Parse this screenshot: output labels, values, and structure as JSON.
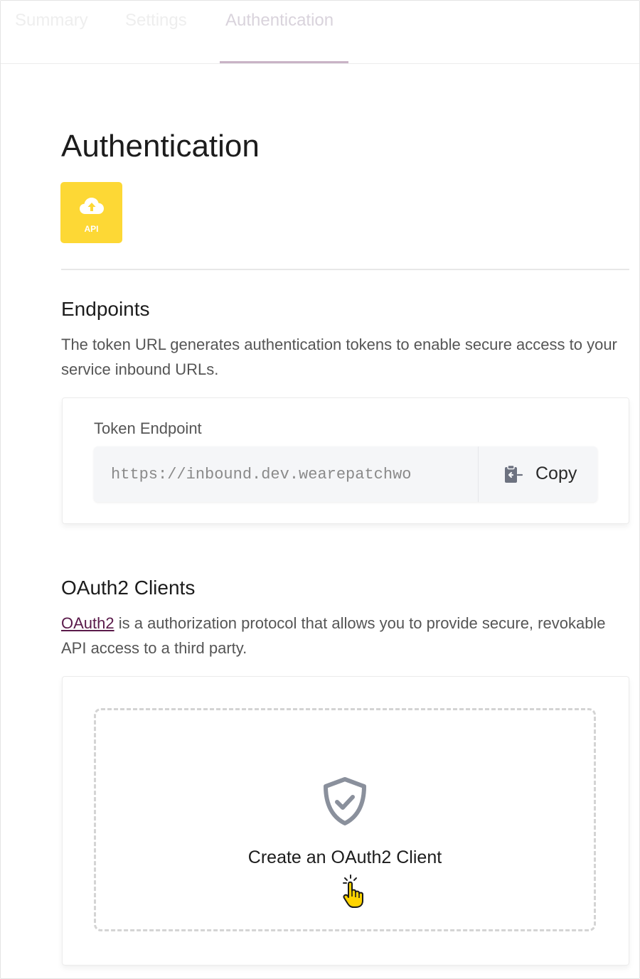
{
  "tabs": [
    {
      "label": "Summary",
      "active": false
    },
    {
      "label": "Settings",
      "active": false
    },
    {
      "label": "Authentication",
      "active": true
    }
  ],
  "page": {
    "title": "Authentication",
    "badge_text": "API",
    "badge_color": "#fdd835",
    "badge_icon": "cloud-upload-icon"
  },
  "endpoints": {
    "title": "Endpoints",
    "description": "The token URL generates authentication tokens to enable secure access to your service inbound URLs.",
    "token_label": "Token Endpoint",
    "token_value": "https://inbound.dev.wearepatchwo",
    "copy_label": "Copy",
    "copy_icon": "clipboard-icon"
  },
  "oauth": {
    "title": "OAuth2 Clients",
    "link_text": "OAuth2",
    "description_rest": " is a authorization protocol that allows you to provide secure, revokable API access to a third party.",
    "create_label": "Create an OAuth2 Client",
    "create_icon": "shield-check-icon",
    "link_color": "#5a1a4a"
  },
  "colors": {
    "tab_underline": "#c9b3c6",
    "text_primary": "#1c1c1c",
    "text_secondary": "#555555"
  }
}
